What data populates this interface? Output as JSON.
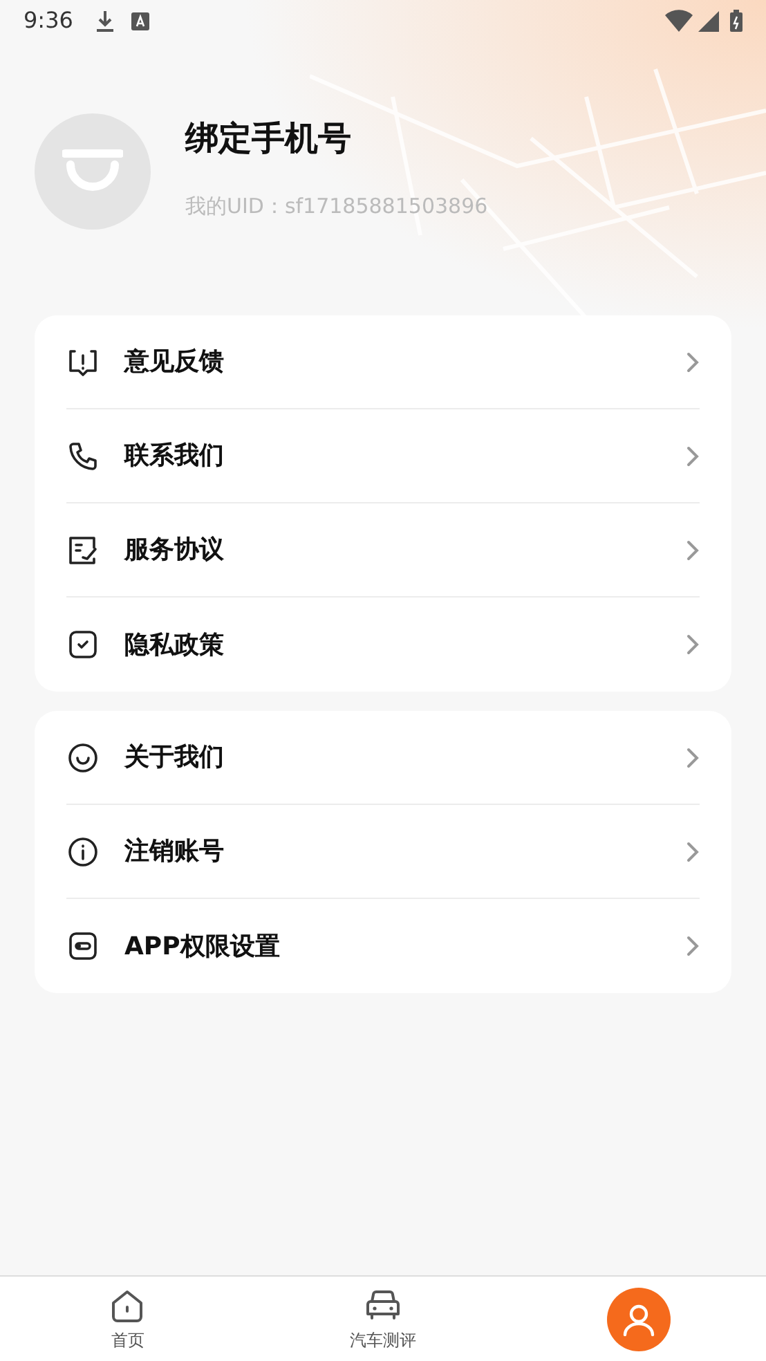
{
  "status_bar": {
    "time": "9:36"
  },
  "profile": {
    "name": "绑定手机号",
    "uid": "我的UID：sf17185881503896"
  },
  "menu_groups": [
    {
      "items": [
        {
          "label": "意见反馈",
          "kind": "feedback"
        },
        {
          "label": "联系我们",
          "kind": "phone"
        },
        {
          "label": "服务协议",
          "kind": "agreement"
        },
        {
          "label": "隐私政策",
          "kind": "privacy"
        }
      ]
    },
    {
      "items": [
        {
          "label": "关于我们",
          "kind": "about"
        },
        {
          "label": "注销账号",
          "kind": "info"
        },
        {
          "label": "APP权限设置",
          "kind": "permission"
        }
      ]
    }
  ],
  "bottom_nav": [
    {
      "label": "首页",
      "kind": "home",
      "selected": false
    },
    {
      "label": "汽车测评",
      "kind": "car",
      "selected": false
    },
    {
      "kind": "profile",
      "selected": true
    }
  ]
}
